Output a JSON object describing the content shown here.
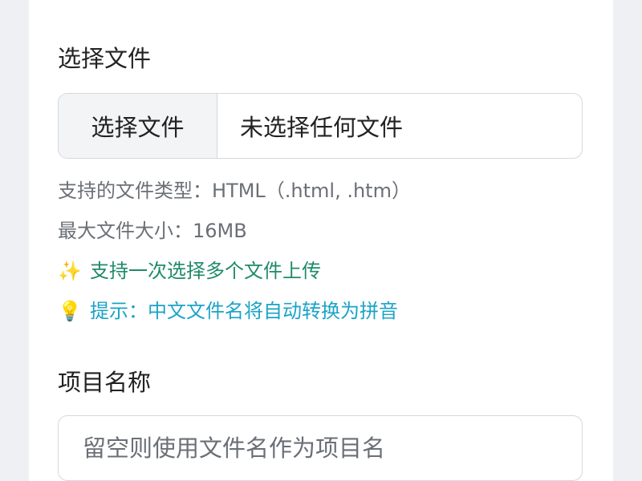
{
  "file_section": {
    "label": "选择文件",
    "button_label": "选择文件",
    "status": "未选择任何文件",
    "supported_types": "支持的文件类型：HTML（.html, .htm）",
    "max_size": "最大文件大小：16MB",
    "multi_hint": "支持一次选择多个文件上传",
    "multi_icon": "sparkles-icon",
    "pinyin_hint": "提示：中文文件名将自动转换为拼音",
    "pinyin_icon": "lightbulb-icon"
  },
  "project_section": {
    "label": "项目名称",
    "placeholder": "留空则使用文件名作为项目名"
  },
  "colors": {
    "background": "#eef0f4",
    "card": "#ffffff",
    "success_hint": "#1f8a6a",
    "info_hint": "#1aa3c7"
  }
}
